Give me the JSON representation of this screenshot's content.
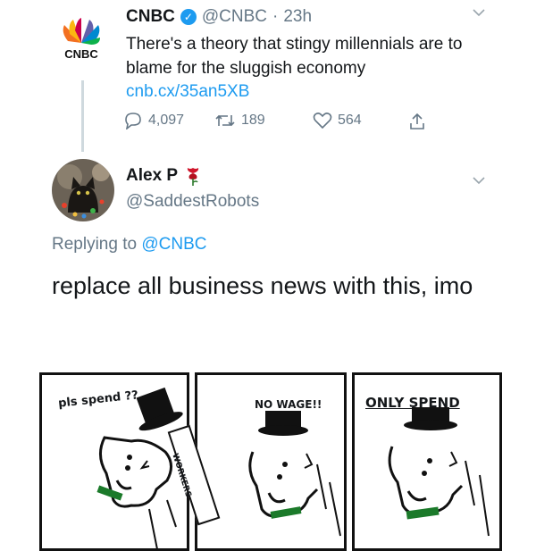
{
  "tweet": {
    "author": "CNBC",
    "logo_text": "CNBC",
    "handle": "@CNBC",
    "separator": "·",
    "time": "23h",
    "text": "There's a theory that stingy millennials are to blame for the sluggish economy",
    "link": "cnb.cx/35an5XB",
    "replies": "4,097",
    "retweets": "189",
    "likes": "564"
  },
  "reply": {
    "author": "Alex P",
    "handle": "@SaddestRobots",
    "replying_prefix": "Replying to",
    "replying_to": "@CNBC",
    "text": "replace all business news with this, imo"
  },
  "comic": {
    "panel1_caption": "pls spend ??",
    "panel2_caption": "NO WAGE!!",
    "panel3_caption": "ONLY SPEND",
    "scarf_text": "WORKERS"
  },
  "colors": {
    "link": "#1d9bf0",
    "muted": "#657786",
    "verified": "#1d9bf0"
  }
}
